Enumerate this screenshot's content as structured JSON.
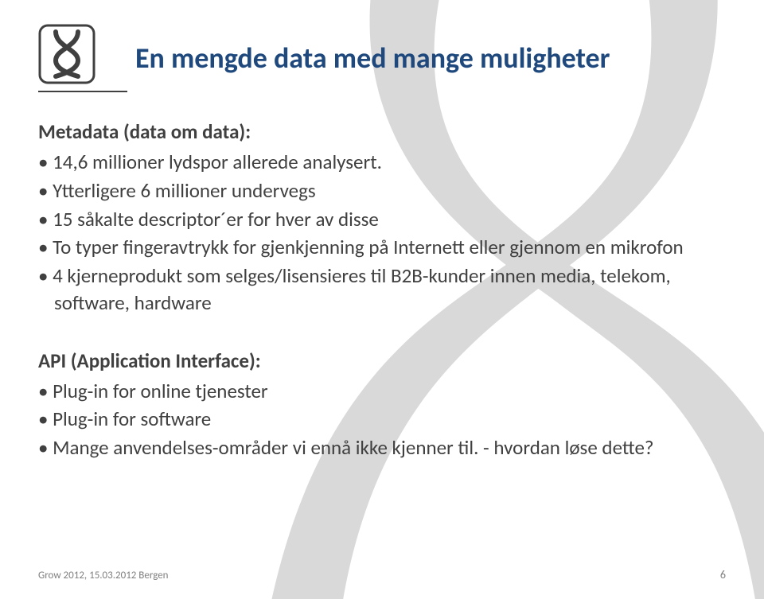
{
  "title": "En mengde data med mange muligheter",
  "section1": {
    "heading": "Metadata (data om data):",
    "items": [
      "14,6 millioner lydspor allerede analysert.",
      "Ytterligere 6 millioner undervegs",
      "15 såkalte descriptor´er for hver av disse",
      "To typer fingeravtrykk for gjenkjenning på Internett eller gjennom en mikrofon",
      "4 kjerneprodukt som selges/lisensieres til B2B-kunder innen media, telekom, software, hardware"
    ]
  },
  "section2": {
    "heading": "API (Application Interface):",
    "items": [
      "Plug-in for online tjenester",
      "Plug-in for software",
      "Mange anvendelses-områder vi ennå ikke kjenner til.   -  hvordan løse dette?"
    ]
  },
  "footer": {
    "left": "Grow 2012, 15.03.2012 Bergen",
    "page": "6"
  }
}
